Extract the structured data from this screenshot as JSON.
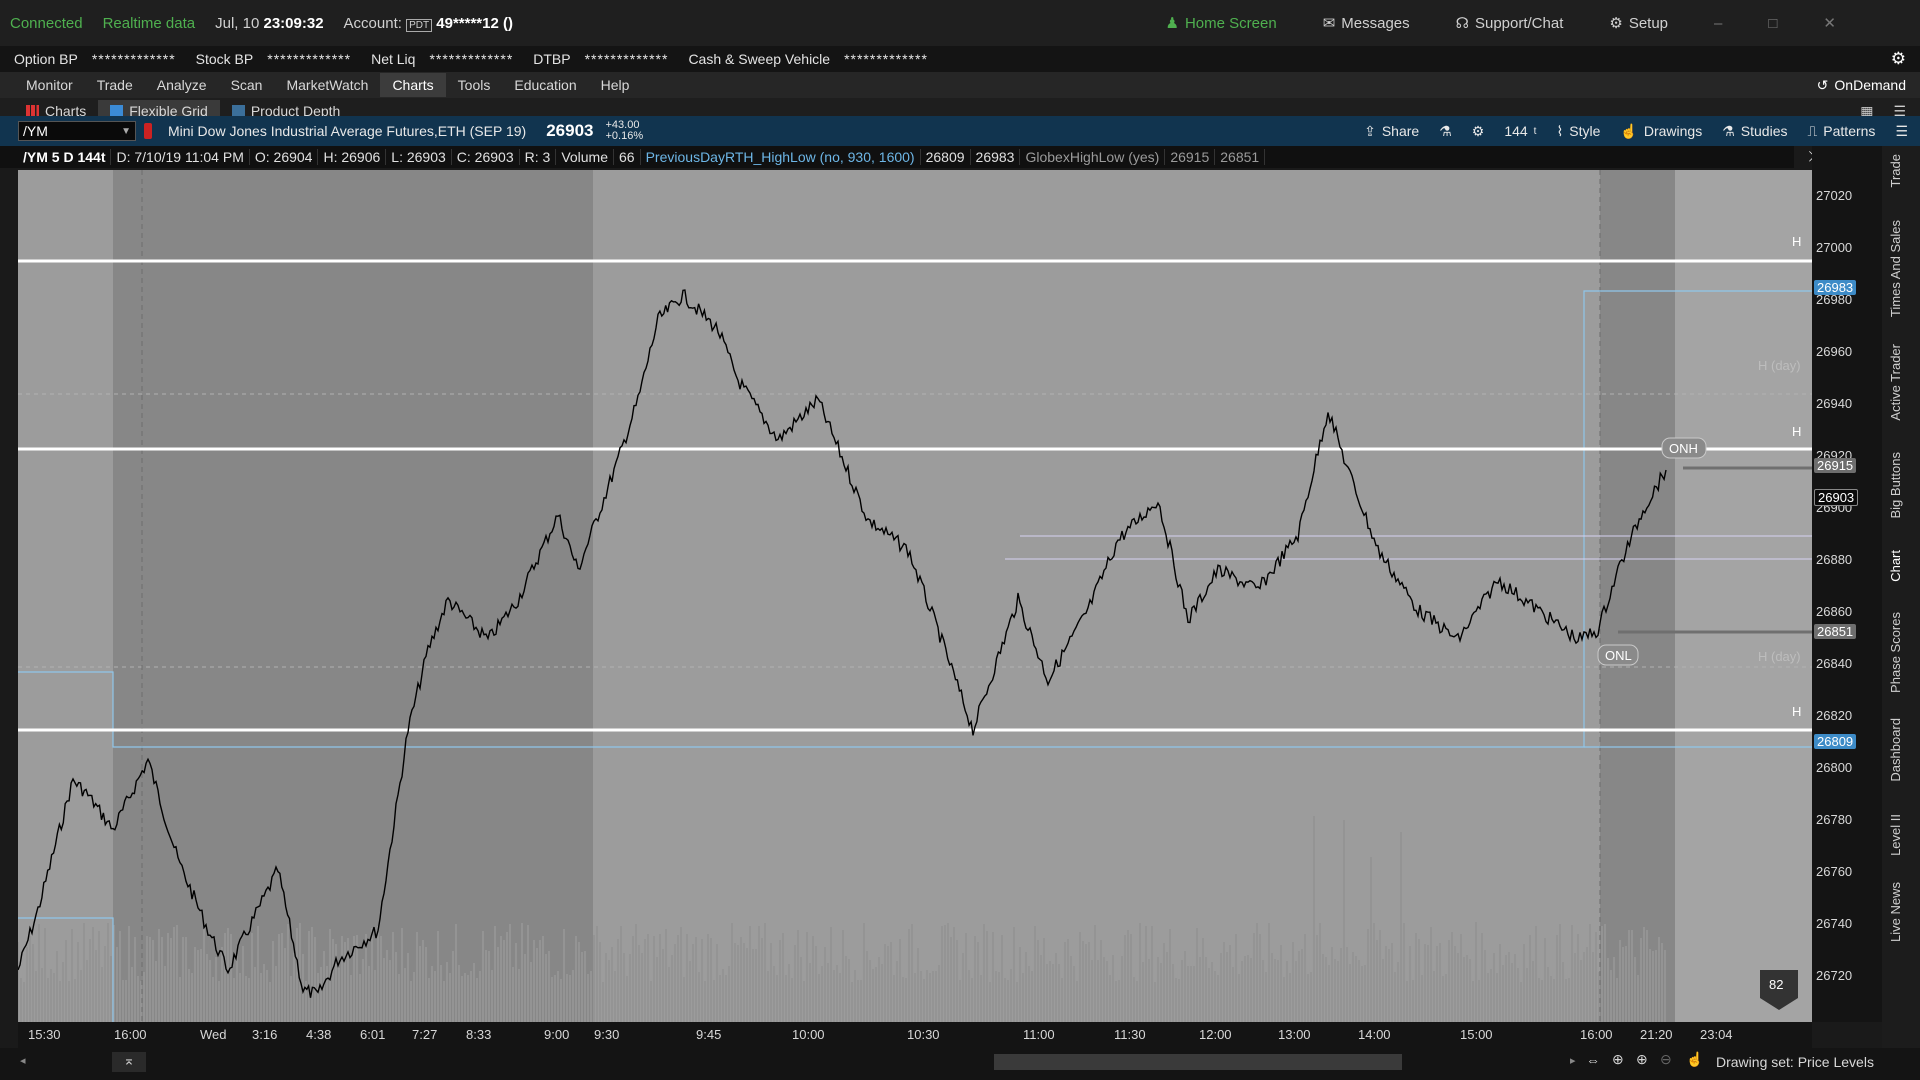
{
  "status": {
    "connected": "Connected",
    "realtime": "Realtime data",
    "date": "Jul, 10",
    "time": "23:09:32",
    "account_label": "Account:",
    "pdt": "PDT",
    "account_value": "49*****12 ()",
    "home": "Home Screen",
    "messages": "Messages",
    "support": "Support/Chat",
    "setup": "Setup"
  },
  "account_bar": [
    {
      "label": "Option BP",
      "value": "*************"
    },
    {
      "label": "Stock BP",
      "value": "*************"
    },
    {
      "label": "Net Liq",
      "value": "*************"
    },
    {
      "label": "DTBP",
      "value": "*************"
    },
    {
      "label": "Cash & Sweep Vehicle",
      "value": "*************"
    }
  ],
  "menu": [
    "Monitor",
    "Trade",
    "Analyze",
    "Scan",
    "MarketWatch",
    "Charts",
    "Tools",
    "Education",
    "Help"
  ],
  "menu_active": "Charts",
  "ondemand": "OnDemand",
  "subtabs": [
    "Charts",
    "Flexible Grid",
    "Product Depth"
  ],
  "symbol_bar": {
    "symbol": "/YM",
    "description": "Mini Dow Jones Industrial Average Futures,ETH (SEP 19)",
    "last": "26903",
    "change": "+43.00",
    "change_pct": "+0.16%",
    "share": "Share",
    "ticks": "144",
    "ticks_unit": "t",
    "style": "Style",
    "drawings": "Drawings",
    "studies": "Studies",
    "patterns": "Patterns"
  },
  "info_bar": {
    "symbol_period": "/YM 5 D 144t",
    "datetime": "D: 7/10/19 11:04 PM",
    "open": "O: 26904",
    "high": "H: 26906",
    "low": "L: 26903",
    "close": "C: 26903",
    "range": "R: 3",
    "volume_label": "Volume",
    "volume": "66",
    "study1": "PreviousDayRTH_HighLow (no, 930, 1600)",
    "study1_v1": "26809",
    "study1_v2": "26983",
    "study2": "GlobexHighLow (yes)",
    "study2_v1": "26915",
    "study2_v2": "26851"
  },
  "price_axis": {
    "ticks": [
      "27020",
      "27000",
      "26980",
      "26960",
      "26940",
      "26920",
      "26900",
      "26880",
      "26860",
      "26840",
      "26820",
      "26800",
      "26780",
      "26760",
      "26740",
      "26720"
    ],
    "tags": {
      "prev_high": "26983",
      "onh": "26915",
      "last": "26903",
      "onl": "26851",
      "prev_low": "26809"
    }
  },
  "chart_labels": {
    "h_upper": "H",
    "h_mid": "H",
    "h_lower": "H",
    "h_day_upper": "H (day)",
    "h_day_lower": "H (day)",
    "onh": "ONH",
    "onl": "ONL",
    "badge": "82"
  },
  "time_axis": [
    "15:30",
    "16:00",
    "Wed",
    "3:16",
    "4:38",
    "6:01",
    "7:27",
    "8:33",
    "9:00",
    "9:30",
    "9:45",
    "10:00",
    "10:30",
    "11:00",
    "11:30",
    "12:00",
    "13:00",
    "14:00",
    "15:00",
    "16:00",
    "21:20",
    "23:04"
  ],
  "bottom": {
    "drawing_set": "Drawing set: Price Levels"
  },
  "right_rail": [
    "Trade",
    "Times And Sales",
    "Active Trader",
    "Big Buttons",
    "Chart",
    "Phase Scores",
    "Dashboard",
    "Level II",
    "Live News"
  ],
  "colors": {
    "accent_blue": "#11344f",
    "price_up": "#4fb04f",
    "level_line": "#ffffff",
    "study_blue": "#8fc6ea"
  }
}
